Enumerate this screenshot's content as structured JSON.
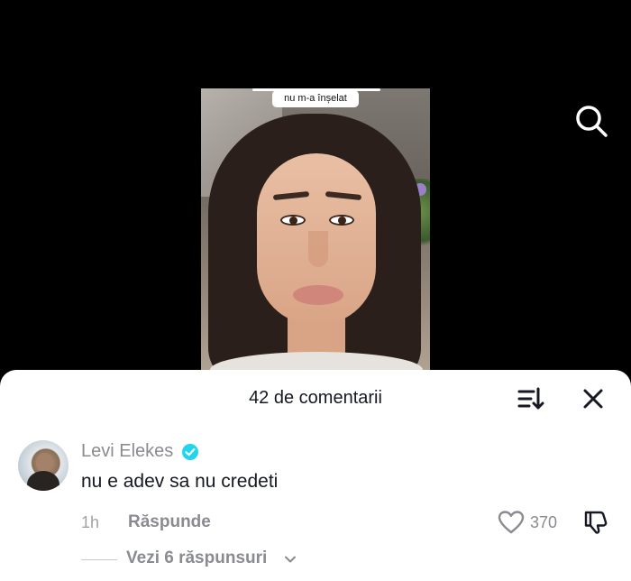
{
  "video": {
    "caption": "nu m-a înșelat"
  },
  "comments_sheet": {
    "title": "42 de comentarii"
  },
  "comment": {
    "username": "Levi Elekes",
    "text": "nu e adev sa nu credeti",
    "time": "1h",
    "reply_label": "Răspunde",
    "like_count": "370",
    "view_replies_label": "Vezi 6 răspunsuri"
  },
  "icons": {
    "search": "search-icon",
    "sort": "sort-icon",
    "close": "close-icon",
    "verified": "verified-badge-icon",
    "like": "heart-icon",
    "dislike": "dislike-icon",
    "expand": "chevron-down-icon"
  },
  "colors": {
    "verified": "#20d5ec",
    "sheet_background": "#ffffff",
    "video_background": "#000000"
  }
}
